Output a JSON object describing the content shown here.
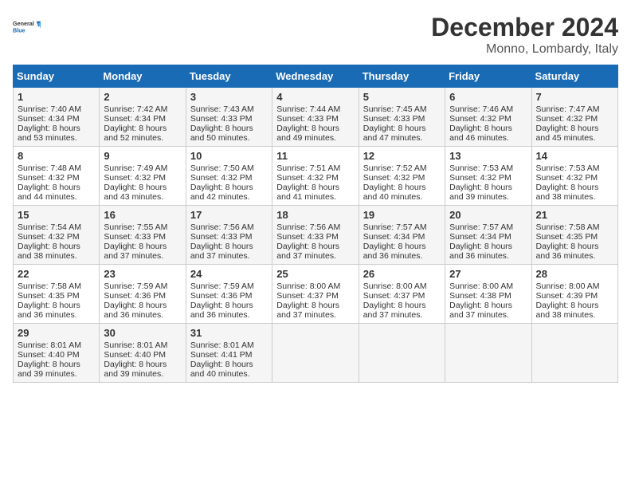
{
  "header": {
    "logo_line1": "General",
    "logo_line2": "Blue",
    "title": "December 2024",
    "subtitle": "Monno, Lombardy, Italy"
  },
  "weekdays": [
    "Sunday",
    "Monday",
    "Tuesday",
    "Wednesday",
    "Thursday",
    "Friday",
    "Saturday"
  ],
  "weeks": [
    [
      {
        "day": "1",
        "lines": [
          "Sunrise: 7:40 AM",
          "Sunset: 4:34 PM",
          "Daylight: 8 hours",
          "and 53 minutes."
        ]
      },
      {
        "day": "2",
        "lines": [
          "Sunrise: 7:42 AM",
          "Sunset: 4:34 PM",
          "Daylight: 8 hours",
          "and 52 minutes."
        ]
      },
      {
        "day": "3",
        "lines": [
          "Sunrise: 7:43 AM",
          "Sunset: 4:33 PM",
          "Daylight: 8 hours",
          "and 50 minutes."
        ]
      },
      {
        "day": "4",
        "lines": [
          "Sunrise: 7:44 AM",
          "Sunset: 4:33 PM",
          "Daylight: 8 hours",
          "and 49 minutes."
        ]
      },
      {
        "day": "5",
        "lines": [
          "Sunrise: 7:45 AM",
          "Sunset: 4:33 PM",
          "Daylight: 8 hours",
          "and 47 minutes."
        ]
      },
      {
        "day": "6",
        "lines": [
          "Sunrise: 7:46 AM",
          "Sunset: 4:32 PM",
          "Daylight: 8 hours",
          "and 46 minutes."
        ]
      },
      {
        "day": "7",
        "lines": [
          "Sunrise: 7:47 AM",
          "Sunset: 4:32 PM",
          "Daylight: 8 hours",
          "and 45 minutes."
        ]
      }
    ],
    [
      {
        "day": "8",
        "lines": [
          "Sunrise: 7:48 AM",
          "Sunset: 4:32 PM",
          "Daylight: 8 hours",
          "and 44 minutes."
        ]
      },
      {
        "day": "9",
        "lines": [
          "Sunrise: 7:49 AM",
          "Sunset: 4:32 PM",
          "Daylight: 8 hours",
          "and 43 minutes."
        ]
      },
      {
        "day": "10",
        "lines": [
          "Sunrise: 7:50 AM",
          "Sunset: 4:32 PM",
          "Daylight: 8 hours",
          "and 42 minutes."
        ]
      },
      {
        "day": "11",
        "lines": [
          "Sunrise: 7:51 AM",
          "Sunset: 4:32 PM",
          "Daylight: 8 hours",
          "and 41 minutes."
        ]
      },
      {
        "day": "12",
        "lines": [
          "Sunrise: 7:52 AM",
          "Sunset: 4:32 PM",
          "Daylight: 8 hours",
          "and 40 minutes."
        ]
      },
      {
        "day": "13",
        "lines": [
          "Sunrise: 7:53 AM",
          "Sunset: 4:32 PM",
          "Daylight: 8 hours",
          "and 39 minutes."
        ]
      },
      {
        "day": "14",
        "lines": [
          "Sunrise: 7:53 AM",
          "Sunset: 4:32 PM",
          "Daylight: 8 hours",
          "and 38 minutes."
        ]
      }
    ],
    [
      {
        "day": "15",
        "lines": [
          "Sunrise: 7:54 AM",
          "Sunset: 4:32 PM",
          "Daylight: 8 hours",
          "and 38 minutes."
        ]
      },
      {
        "day": "16",
        "lines": [
          "Sunrise: 7:55 AM",
          "Sunset: 4:33 PM",
          "Daylight: 8 hours",
          "and 37 minutes."
        ]
      },
      {
        "day": "17",
        "lines": [
          "Sunrise: 7:56 AM",
          "Sunset: 4:33 PM",
          "Daylight: 8 hours",
          "and 37 minutes."
        ]
      },
      {
        "day": "18",
        "lines": [
          "Sunrise: 7:56 AM",
          "Sunset: 4:33 PM",
          "Daylight: 8 hours",
          "and 37 minutes."
        ]
      },
      {
        "day": "19",
        "lines": [
          "Sunrise: 7:57 AM",
          "Sunset: 4:34 PM",
          "Daylight: 8 hours",
          "and 36 minutes."
        ]
      },
      {
        "day": "20",
        "lines": [
          "Sunrise: 7:57 AM",
          "Sunset: 4:34 PM",
          "Daylight: 8 hours",
          "and 36 minutes."
        ]
      },
      {
        "day": "21",
        "lines": [
          "Sunrise: 7:58 AM",
          "Sunset: 4:35 PM",
          "Daylight: 8 hours",
          "and 36 minutes."
        ]
      }
    ],
    [
      {
        "day": "22",
        "lines": [
          "Sunrise: 7:58 AM",
          "Sunset: 4:35 PM",
          "Daylight: 8 hours",
          "and 36 minutes."
        ]
      },
      {
        "day": "23",
        "lines": [
          "Sunrise: 7:59 AM",
          "Sunset: 4:36 PM",
          "Daylight: 8 hours",
          "and 36 minutes."
        ]
      },
      {
        "day": "24",
        "lines": [
          "Sunrise: 7:59 AM",
          "Sunset: 4:36 PM",
          "Daylight: 8 hours",
          "and 36 minutes."
        ]
      },
      {
        "day": "25",
        "lines": [
          "Sunrise: 8:00 AM",
          "Sunset: 4:37 PM",
          "Daylight: 8 hours",
          "and 37 minutes."
        ]
      },
      {
        "day": "26",
        "lines": [
          "Sunrise: 8:00 AM",
          "Sunset: 4:37 PM",
          "Daylight: 8 hours",
          "and 37 minutes."
        ]
      },
      {
        "day": "27",
        "lines": [
          "Sunrise: 8:00 AM",
          "Sunset: 4:38 PM",
          "Daylight: 8 hours",
          "and 37 minutes."
        ]
      },
      {
        "day": "28",
        "lines": [
          "Sunrise: 8:00 AM",
          "Sunset: 4:39 PM",
          "Daylight: 8 hours",
          "and 38 minutes."
        ]
      }
    ],
    [
      {
        "day": "29",
        "lines": [
          "Sunrise: 8:01 AM",
          "Sunset: 4:40 PM",
          "Daylight: 8 hours",
          "and 39 minutes."
        ]
      },
      {
        "day": "30",
        "lines": [
          "Sunrise: 8:01 AM",
          "Sunset: 4:40 PM",
          "Daylight: 8 hours",
          "and 39 minutes."
        ]
      },
      {
        "day": "31",
        "lines": [
          "Sunrise: 8:01 AM",
          "Sunset: 4:41 PM",
          "Daylight: 8 hours",
          "and 40 minutes."
        ]
      },
      null,
      null,
      null,
      null
    ]
  ]
}
